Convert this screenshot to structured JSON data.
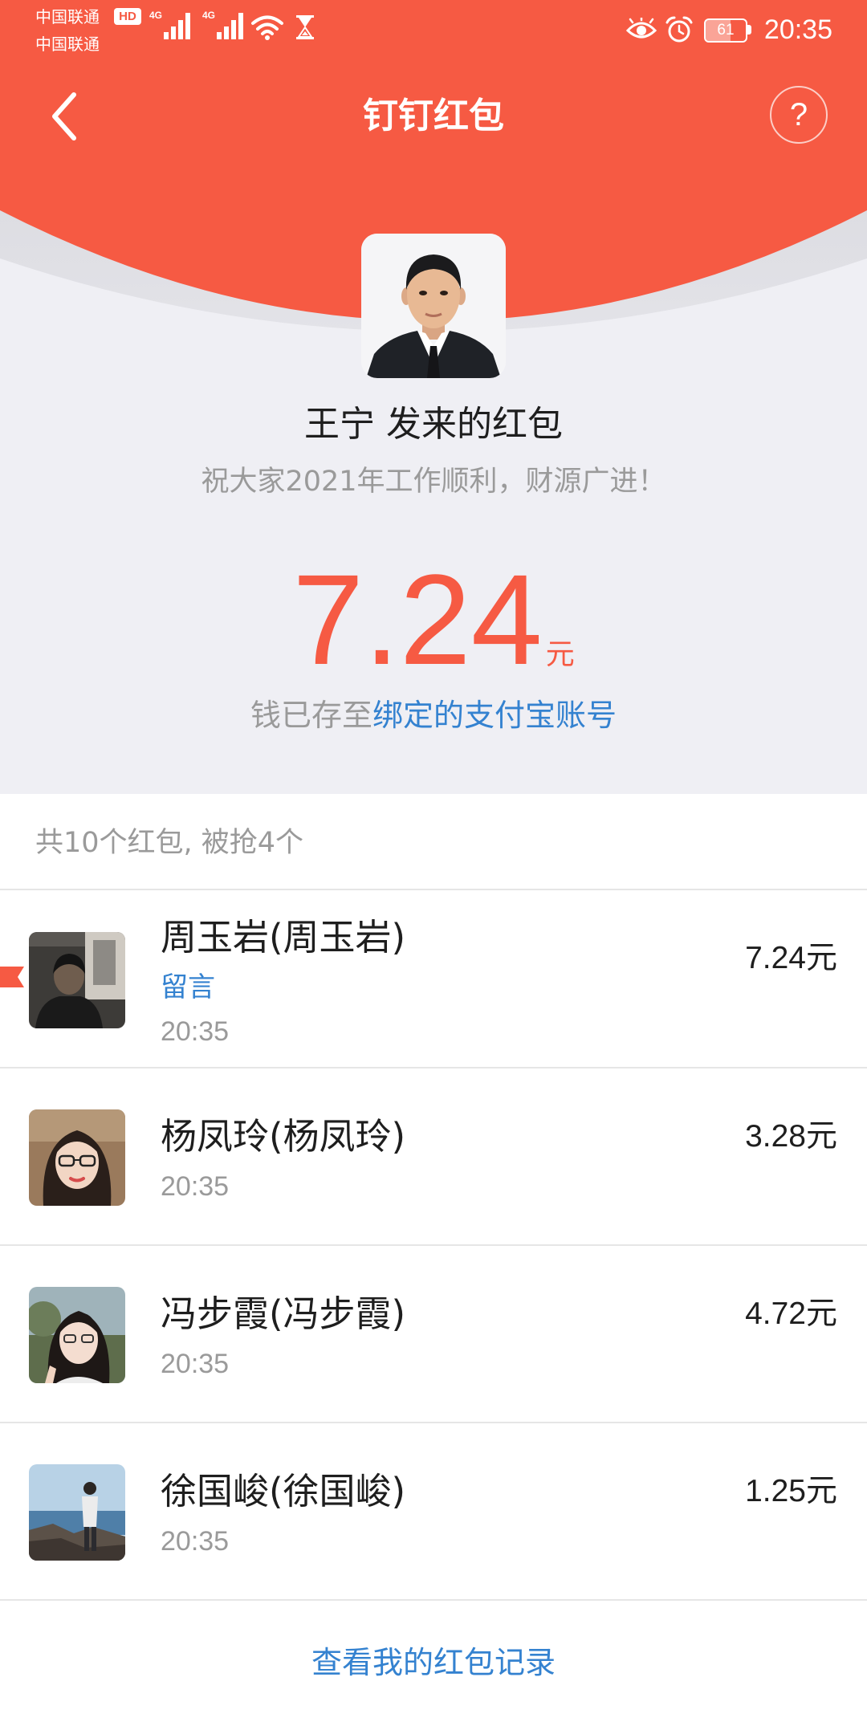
{
  "theme": {
    "accent": "#F65A43",
    "link": "#3482D0",
    "background": "#EFEFF4"
  },
  "status_bar": {
    "carrier_primary": "中国联通",
    "hd_badge": "HD",
    "carrier_secondary": "中国联通",
    "sim1_network": "4G",
    "sim2_network": "4G",
    "battery_level": "61",
    "battery_fraction": 0.61,
    "time": "20:35",
    "icons": {
      "signal": "signal-icon",
      "wifi": "wifi-icon",
      "hourglass": "hourglass-icon",
      "eye": "eye-icon",
      "alarm": "alarm-icon",
      "battery": "battery-icon"
    }
  },
  "header": {
    "title": "钉钉红包",
    "back_icon": "chevron-left-icon",
    "help_label": "?"
  },
  "sender": {
    "title": "王宁 发来的红包",
    "blessing": "祝大家2021年工作顺利，财源广进！"
  },
  "received": {
    "amount": "7.24",
    "unit": "元",
    "deposit_prefix": "钱已存至",
    "deposit_link": "绑定的支付宝账号"
  },
  "summary": "共10个红包, 被抢4个",
  "receivers": [
    {
      "name": "周玉岩(周玉岩)",
      "message_link": "留言",
      "time": "20:35",
      "amount": "7.24元",
      "flagged": true
    },
    {
      "name": "杨凤玲(杨凤玲)",
      "time": "20:35",
      "amount": "3.28元"
    },
    {
      "name": "冯步霞(冯步霞)",
      "time": "20:35",
      "amount": "4.72元"
    },
    {
      "name": "徐国峻(徐国峻)",
      "time": "20:35",
      "amount": "1.25元"
    }
  ],
  "footer": {
    "history_link": "查看我的红包记录"
  }
}
